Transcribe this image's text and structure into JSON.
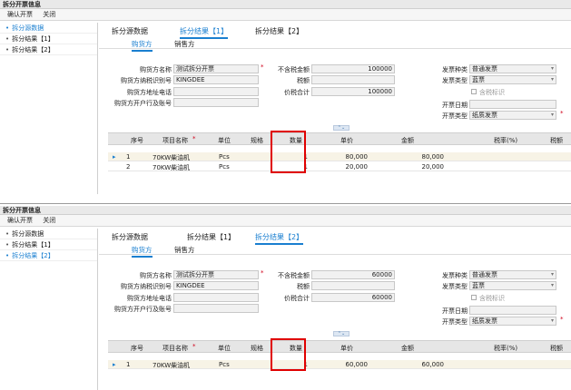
{
  "dialog_title": "拆分开票信息",
  "menu": {
    "confirm": "确认开票",
    "close": "关闭"
  },
  "nav": [
    "拆分源数据",
    "拆分结果【1】",
    "拆分结果【2】"
  ],
  "tabs": [
    "拆分源数据",
    "拆分结果【1】",
    "拆分结果【2】"
  ],
  "subtabs": [
    "购货方",
    "销售方"
  ],
  "labels": {
    "buyer_name": "购货方名称",
    "buyer_tax_id": "购货方纳税识别号",
    "buyer_address": "购货方地址电话",
    "buyer_bank": "购货方开户行及账号",
    "amount_ex_tax": "不含税金额",
    "tax": "税额",
    "total": "价税合计",
    "invoice_kind": "发票种类",
    "invoice_type": "发票类型",
    "tax_flag": "含税标识",
    "invoice_date": "开票日期",
    "invoice_no": "开票日期",
    "issue_type": "开票类型"
  },
  "grid_headers": [
    "序号",
    "项目名称",
    "单位",
    "规格",
    "数量",
    "单价",
    "金额",
    "税率(%)",
    "税额"
  ],
  "panel1": {
    "buyer_name": "测试拆分开票",
    "buyer_tax_id": "KINGDEE",
    "amount_ex_tax": "100000",
    "total": "100000",
    "invoice_kind": "普通发票",
    "invoice_type": "蓝票",
    "issue_type": "纸质发票",
    "rows": [
      {
        "no": "1",
        "name": "70KW柴油机",
        "unit": "Pcs",
        "qty": "1",
        "price": "80,000",
        "amount": "80,000"
      },
      {
        "no": "2",
        "name": "70KW柴油机",
        "unit": "Pcs",
        "qty": "1",
        "price": "20,000",
        "amount": "20,000"
      }
    ]
  },
  "panel2": {
    "buyer_name": "测试拆分开票",
    "buyer_tax_id": "KINGDEE",
    "amount_ex_tax": "60000",
    "total": "60000",
    "invoice_kind": "普通发票",
    "invoice_type": "蓝票",
    "issue_type": "纸质发票",
    "rows": [
      {
        "no": "1",
        "name": "70KW柴油机",
        "unit": "Pcs",
        "qty": "1",
        "price": "60,000",
        "amount": "60,000"
      }
    ]
  },
  "colors": {
    "accent": "#1a7fd0",
    "highlight_box": "#e00000"
  }
}
